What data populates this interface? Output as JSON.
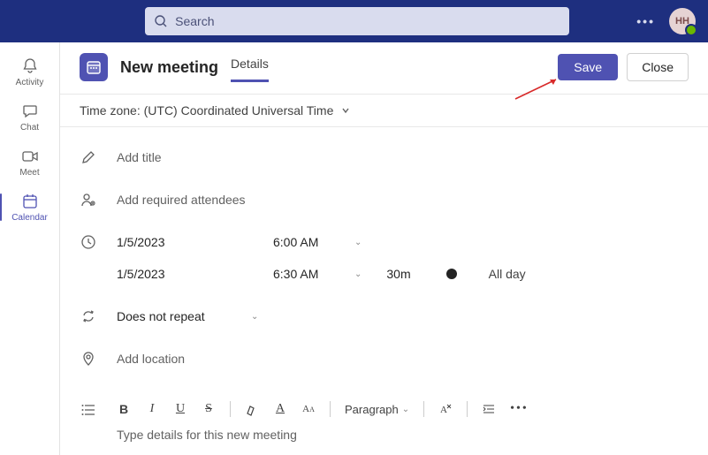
{
  "topbar": {
    "search_placeholder": "Search",
    "avatar_initials": "HH"
  },
  "rail": {
    "items": [
      {
        "label": "Activity"
      },
      {
        "label": "Chat"
      },
      {
        "label": "Meet"
      },
      {
        "label": "Calendar"
      }
    ]
  },
  "header": {
    "title": "New meeting",
    "tab_label": "Details",
    "save_label": "Save",
    "close_label": "Close"
  },
  "timezone": {
    "label": "Time zone: (UTC) Coordinated Universal Time"
  },
  "form": {
    "title_placeholder": "Add title",
    "attendees_placeholder": "Add required attendees",
    "start_date": "1/5/2023",
    "start_time": "6:00 AM",
    "end_date": "1/5/2023",
    "end_time": "6:30 AM",
    "duration": "30m",
    "allday_label": "All day",
    "repeat_value": "Does not repeat",
    "location_placeholder": "Add location",
    "toolbar": {
      "paragraph": "Paragraph"
    },
    "description_placeholder": "Type details for this new meeting"
  }
}
